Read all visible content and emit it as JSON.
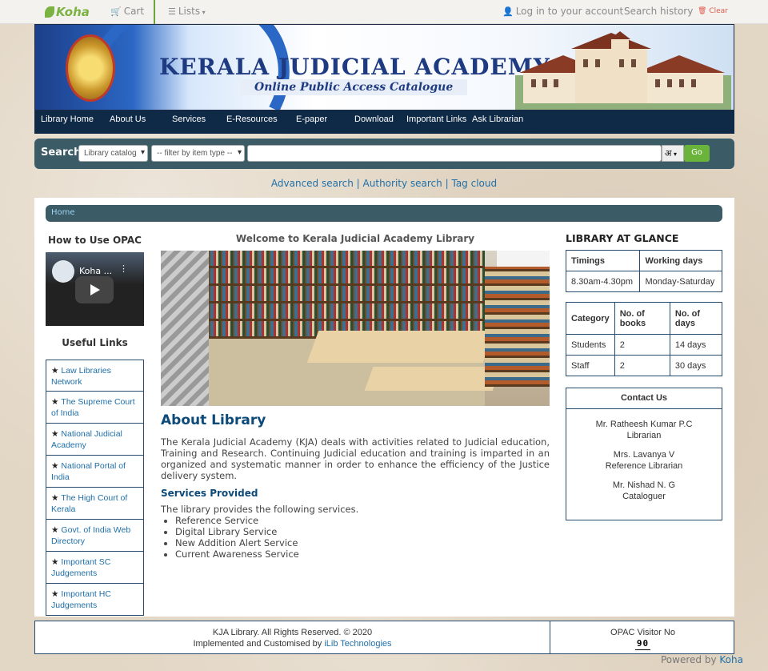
{
  "topbar": {
    "logo": "Koha",
    "cart": "Cart",
    "lists": "Lists",
    "login": "Log in to your account",
    "search_history": "Search history",
    "clear": "Clear"
  },
  "banner": {
    "title": "KERALA JUDICIAL ACADEMY",
    "subtitle": "Online Public Access Catalogue"
  },
  "menu": [
    "Library Home",
    "About Us",
    "Services",
    "E-Resources",
    "E-paper",
    "Download",
    "Important Links",
    "Ask Librarian"
  ],
  "search": {
    "label": "Search",
    "catalog_select": "Library catalog",
    "filter_select": "-- filter by item type --",
    "lang_button": "अ",
    "go_button": "Go"
  },
  "links": {
    "advanced": "Advanced search",
    "authority": "Authority search",
    "tag_cloud": "Tag cloud"
  },
  "breadcrumb": "Home",
  "left": {
    "how_to_title": "How to Use OPAC",
    "video_title": "Koha ...",
    "useful_title": "Useful Links",
    "links": [
      "Law Libraries Network",
      "The Supreme Court of India",
      "National Judicial Academy",
      "National Portal of India",
      "The High Court of Kerala",
      "Govt. of India Web Directory",
      "Important SC Judgements",
      "Important HC Judgements"
    ]
  },
  "main": {
    "welcome": "Welcome to Kerala Judicial Academy Library",
    "about_heading": "About Library",
    "about_text": "The Kerala Judicial Academy (KJA) deals with activities related to Judicial education, Training and Research. Continuing Judicial education and training is imparted in an organized and systematic manner in order to enhance the efficiency of the Justice delivery system.",
    "services_heading": "Services Provided",
    "services_intro": "The library provides the following services.",
    "services": [
      "Reference Service",
      "Digital Library Service",
      "New Addition Alert Service",
      "Current Awareness Service"
    ]
  },
  "right": {
    "title": "LIBRARY AT GLANCE",
    "timings_table": {
      "headers": [
        "Timings",
        "Working days"
      ],
      "row": [
        "8.30am-4.30pm",
        "Monday-Saturday"
      ]
    },
    "loan_table": {
      "headers": [
        "Category",
        "No. of books",
        "No. of days"
      ],
      "rows": [
        [
          "Students",
          "2",
          "14 days"
        ],
        [
          "Staff",
          "2",
          "30 days"
        ]
      ]
    },
    "contact": {
      "title": "Contact Us",
      "people": [
        {
          "name": "Mr. Ratheesh Kumar P.C",
          "role": "Librarian"
        },
        {
          "name": "Mrs. Lavanya V",
          "role": "Reference Librarian"
        },
        {
          "name": "Mr. Nishad N. G",
          "role": "Cataloguer"
        }
      ]
    }
  },
  "footer": {
    "copyright": "KJA Library. All Rights Reserved. © 2020",
    "implemented": "Implemented and Customised by",
    "company": "iLib Technologies",
    "visitor_label": "OPAC Visitor No",
    "visitor_count": "90"
  },
  "powered": {
    "text": "Powered by",
    "link": "Koha"
  }
}
